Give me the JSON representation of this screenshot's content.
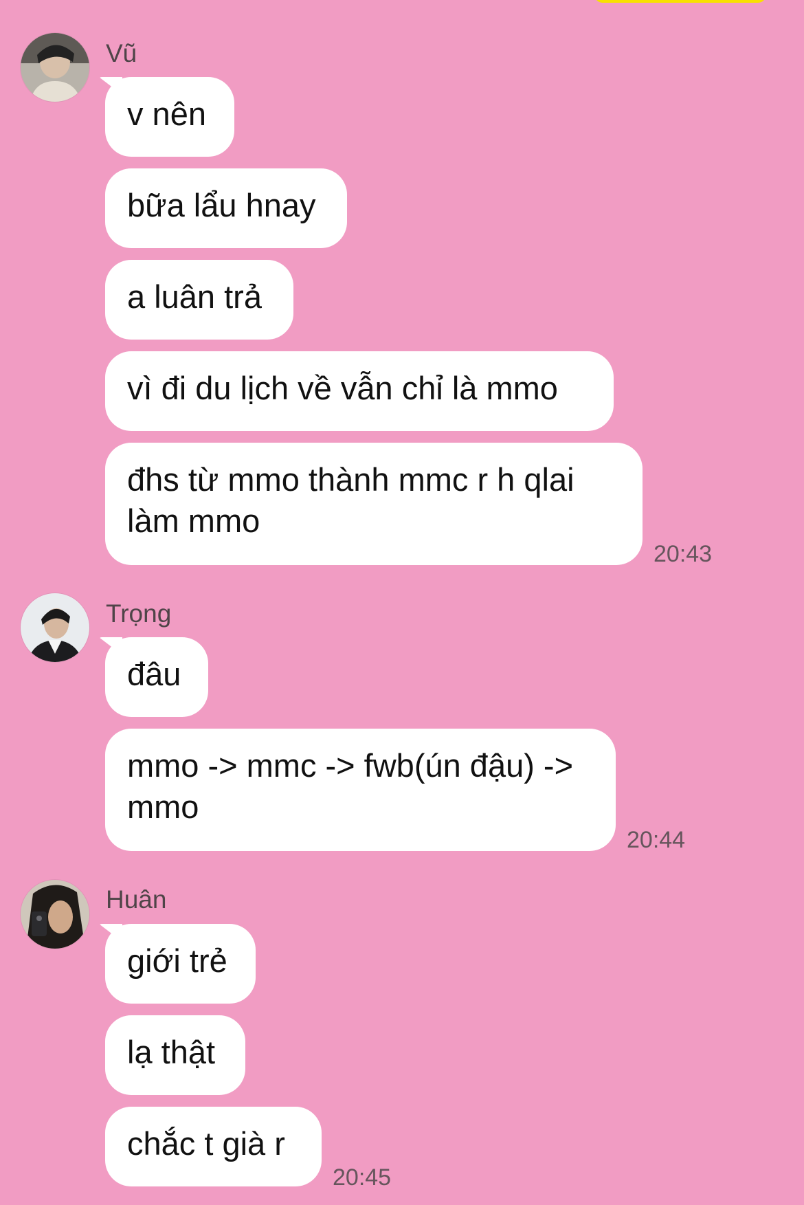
{
  "accent": {
    "background": "#f19cc3",
    "bubble": "#ffffff",
    "top_indicator": "#f8e100"
  },
  "groups": [
    {
      "sender": "Vũ",
      "avatar_icon": "avatar-vu-icon",
      "messages": [
        "v nên",
        "bữa lẩu hnay",
        "a luân trả",
        "vì đi du lịch về vẫn chỉ là mmo",
        "đhs từ mmo thành mmc r h qlai làm mmo"
      ],
      "time": "20:43"
    },
    {
      "sender": "Trọng",
      "avatar_icon": "avatar-trong-icon",
      "messages": [
        "đâu",
        "mmo -> mmc -> fwb(ún đậu) -> mmo"
      ],
      "time": "20:44"
    },
    {
      "sender": "Huân",
      "avatar_icon": "avatar-huan-icon",
      "messages": [
        "giới trẻ",
        "lạ thật",
        "chắc t già r"
      ],
      "time": "20:45"
    }
  ]
}
